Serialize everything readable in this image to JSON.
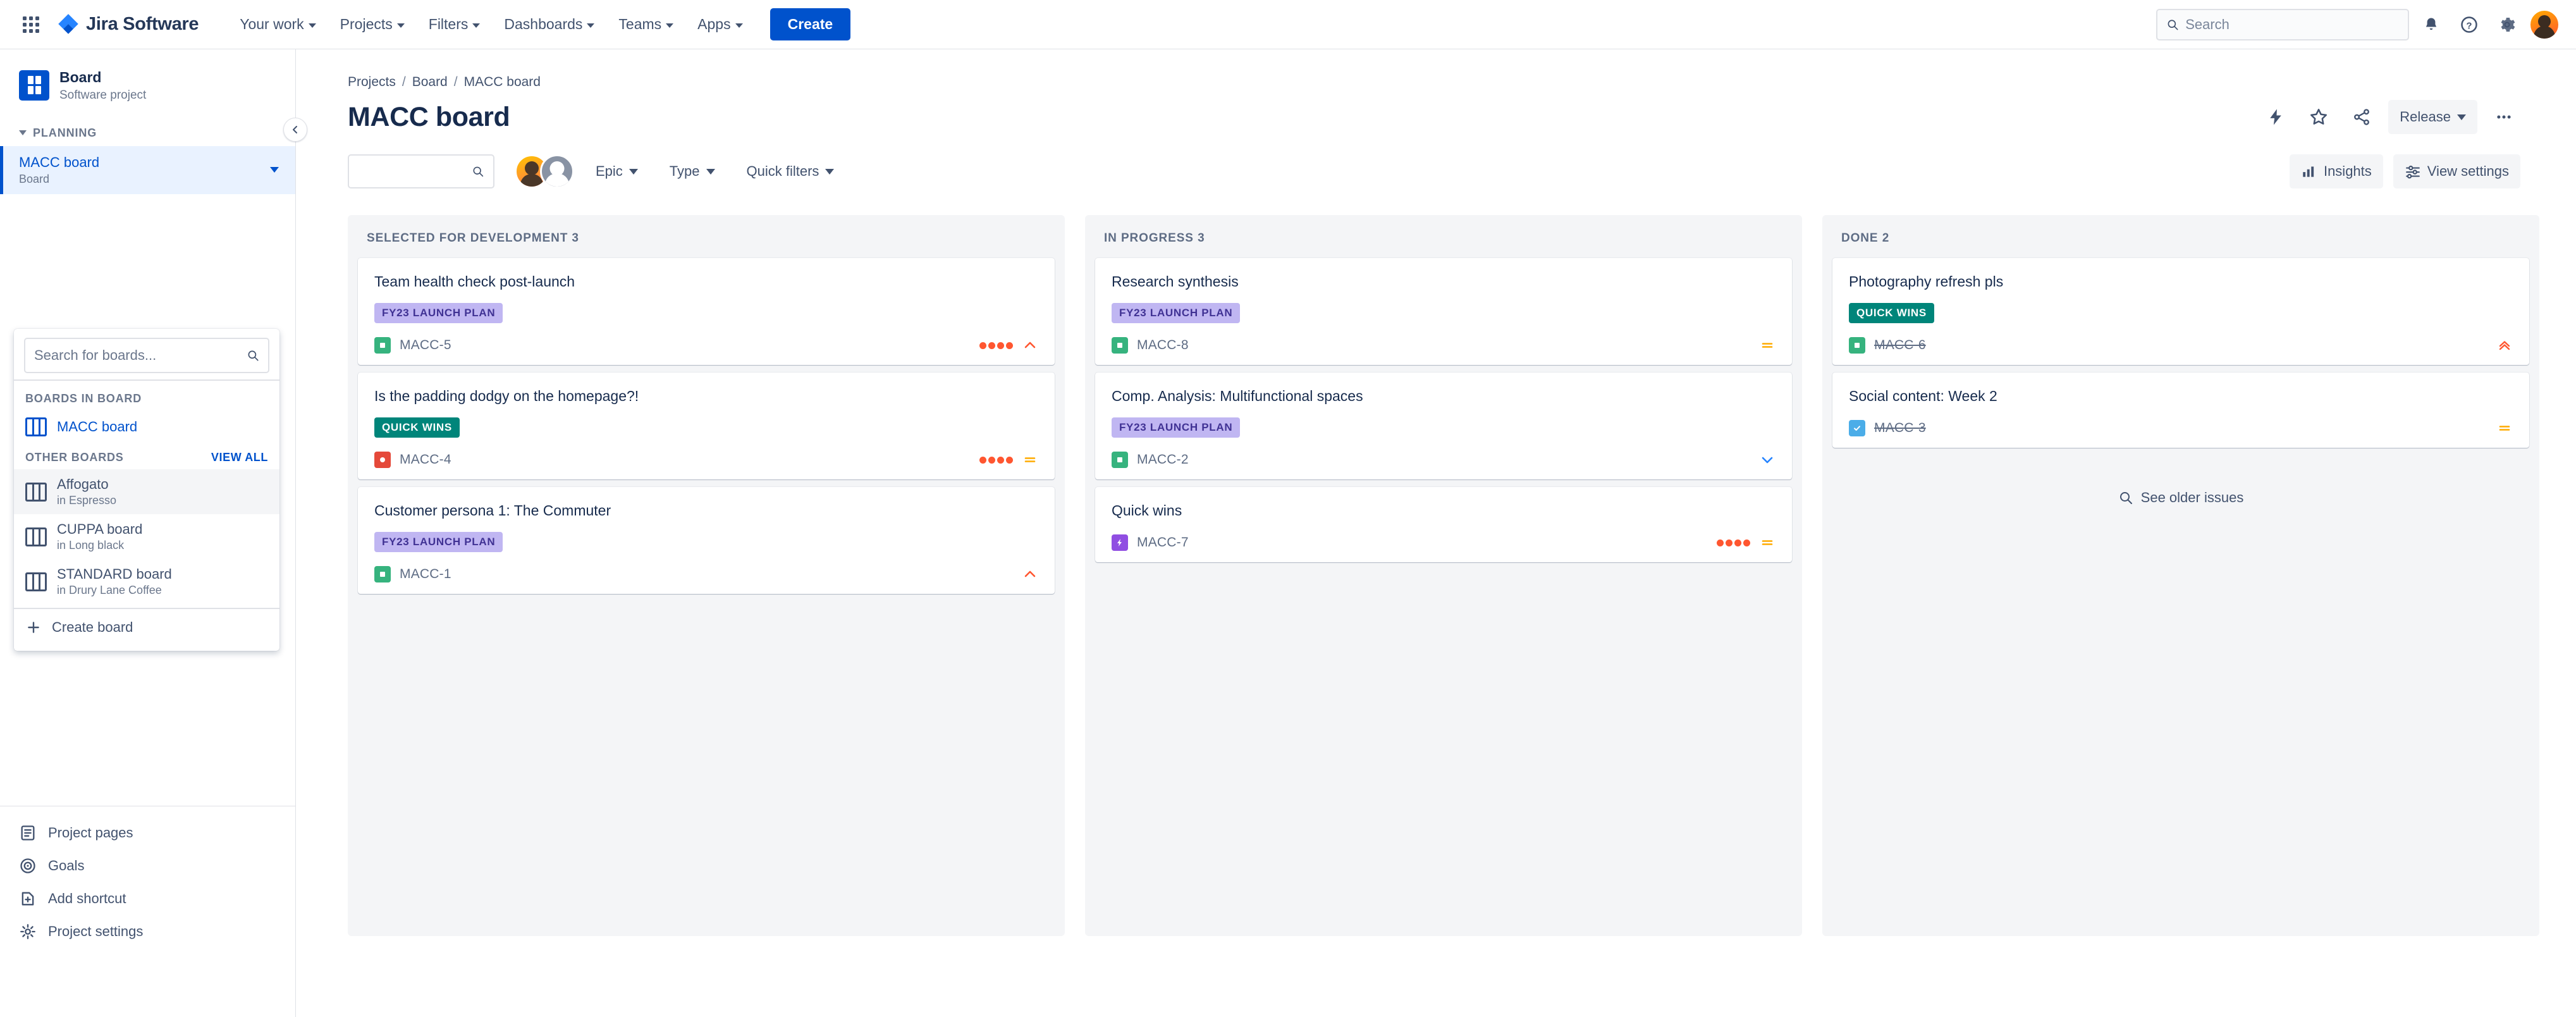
{
  "topnav": {
    "app_switcher": "app-switcher",
    "brand": "Jira Software",
    "links": [
      {
        "label": "Your work",
        "has_caret": true
      },
      {
        "label": "Projects",
        "has_caret": true
      },
      {
        "label": "Filters",
        "has_caret": true
      },
      {
        "label": "Dashboards",
        "has_caret": true
      },
      {
        "label": "Teams",
        "has_caret": true
      },
      {
        "label": "Apps",
        "has_caret": true
      }
    ],
    "create_label": "Create",
    "search_placeholder": "Search",
    "search_value": "",
    "icons": [
      "notifications-icon",
      "help-icon",
      "settings-icon",
      "profile-avatar"
    ]
  },
  "sidebar": {
    "project_name": "Board",
    "project_type": "Software project",
    "collapse_label": "collapse-sidebar",
    "planning_label": "PLANNING",
    "planning_items": [
      {
        "label": "MACC board",
        "sub": "Board",
        "selected": true
      }
    ],
    "board_panel": {
      "search_placeholder": "Search for boards...",
      "search_value": "",
      "boards_in_board_label": "BOARDS IN BOARD",
      "boards_in_board": [
        {
          "label": "MACC board",
          "sub": ""
        }
      ],
      "other_boards_label": "OTHER BOARDS",
      "view_all_label": "VIEW ALL",
      "other_boards": [
        {
          "label": "Affogato",
          "sub": "in Espresso",
          "highlighted": true
        },
        {
          "label": "CUPPA board",
          "sub": "in Long black",
          "highlighted": false
        },
        {
          "label": "STANDARD board",
          "sub": "in Drury Lane Coffee",
          "highlighted": false
        }
      ],
      "create_board_label": "Create board"
    },
    "bottom_items": [
      {
        "label": "Project pages",
        "icon": "pages-icon"
      },
      {
        "label": "Goals",
        "icon": "goals-icon"
      },
      {
        "label": "Add shortcut",
        "icon": "shortcut-icon"
      },
      {
        "label": "Project settings",
        "icon": "settings-gear-icon"
      }
    ]
  },
  "main": {
    "breadcrumb": [
      "Projects",
      "Board",
      "MACC board"
    ],
    "page_title": "MACC board",
    "title_actions": {
      "lightning_label": "automation-icon",
      "star_label": "star-icon",
      "share_label": "share-icon",
      "release_label": "Release",
      "more_label": "more-actions-icon"
    },
    "toolbar": {
      "search_placeholder": "",
      "search_value": "",
      "epic_label": "Epic",
      "type_label": "Type",
      "quick_filters_label": "Quick filters",
      "insights_label": "Insights",
      "view_settings_label": "View settings"
    },
    "columns": [
      {
        "name": "SELECTED FOR DEVELOPMENT",
        "count": "3",
        "cards": [
          {
            "title": "Team health check post-launch",
            "label": "FY23 LAUNCH PLAN",
            "label_style": "fy23",
            "key": "MACC-5",
            "type": "story",
            "dots": 4,
            "priority": "high",
            "done": false
          },
          {
            "title": "Is the padding dodgy on the homepage?!",
            "label": "QUICK WINS",
            "label_style": "qw",
            "key": "MACC-4",
            "type": "bug",
            "dots": 4,
            "priority": "medium",
            "done": false
          },
          {
            "title": "Customer persona 1: The Commuter",
            "label": "FY23 LAUNCH PLAN",
            "label_style": "fy23",
            "key": "MACC-1",
            "type": "story",
            "dots": 0,
            "priority": "high",
            "done": false
          }
        ]
      },
      {
        "name": "IN PROGRESS",
        "count": "3",
        "cards": [
          {
            "title": "Research synthesis",
            "label": "FY23 LAUNCH PLAN",
            "label_style": "fy23",
            "key": "MACC-8",
            "type": "story",
            "dots": 0,
            "priority": "medium",
            "done": false
          },
          {
            "title": "Comp. Analysis: Multifunctional spaces",
            "label": "FY23 LAUNCH PLAN",
            "label_style": "fy23",
            "key": "MACC-2",
            "type": "story",
            "dots": 0,
            "priority": "low",
            "done": false
          },
          {
            "title": "Quick wins",
            "label": "",
            "label_style": "",
            "key": "MACC-7",
            "type": "epic",
            "dots": 4,
            "priority": "medium",
            "done": false
          }
        ]
      },
      {
        "name": "DONE",
        "count": "2",
        "cards": [
          {
            "title": "Photography refresh pls",
            "label": "QUICK WINS",
            "label_style": "qw",
            "key": "MACC-6",
            "type": "story",
            "dots": 0,
            "priority": "highest",
            "done": true
          },
          {
            "title": "Social content: Week 2",
            "label": "",
            "label_style": "",
            "key": "MACC-3",
            "type": "task",
            "dots": 0,
            "priority": "medium",
            "done": true
          }
        ],
        "see_older_label": "See older issues"
      }
    ]
  },
  "colors": {
    "brand_blue": "#0052cc",
    "selected_bg": "#e9f2ff",
    "column_bg": "#f4f5f7",
    "text": "#172b4d",
    "subtle_text": "#6b778c",
    "label_fy23_bg": "#c0b6f2",
    "label_qw_bg": "#00857a",
    "story_green": "#36b37e",
    "bug_red": "#e5493a",
    "task_blue": "#4bade8",
    "epic_purple": "#904ee2",
    "priority_red": "#ff5630",
    "priority_orange": "#ffab00",
    "priority_blue": "#2684ff"
  }
}
